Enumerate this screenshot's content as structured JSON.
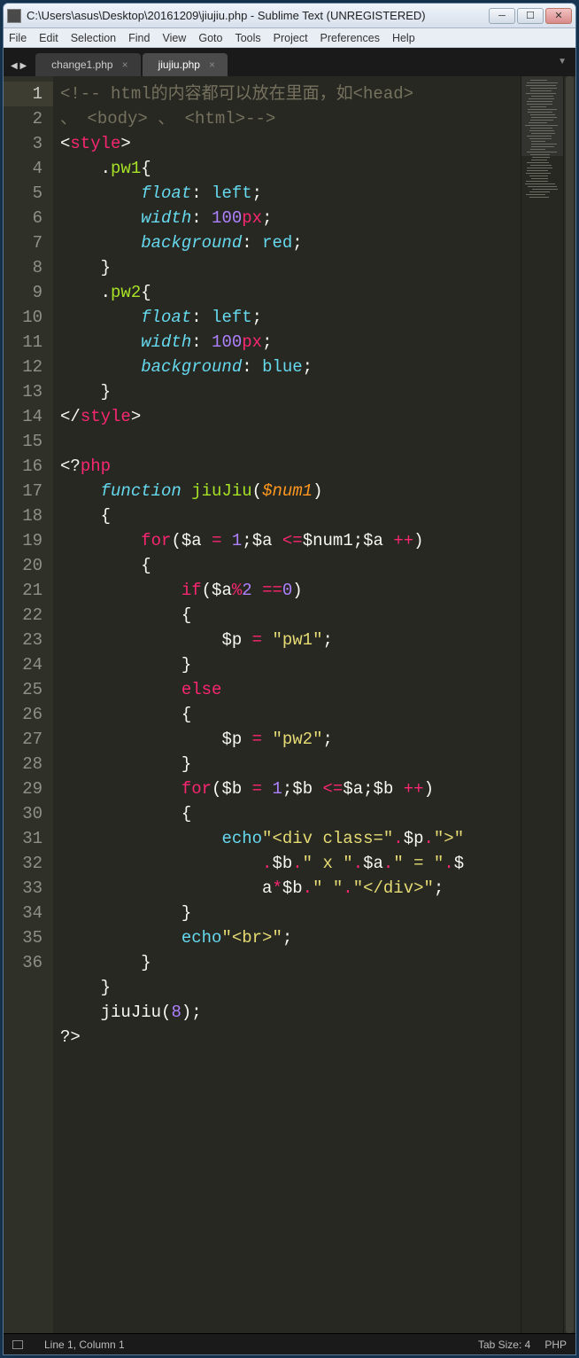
{
  "window": {
    "title": "C:\\Users\\asus\\Desktop\\20161209\\jiujiu.php - Sublime Text (UNREGISTERED)"
  },
  "menu": [
    "File",
    "Edit",
    "Selection",
    "Find",
    "View",
    "Goto",
    "Tools",
    "Project",
    "Preferences",
    "Help"
  ],
  "tabs": [
    {
      "label": "change1.php",
      "active": false
    },
    {
      "label": "jiujiu.php",
      "active": true
    }
  ],
  "status": {
    "left": "Line 1, Column 1",
    "tabSize": "Tab Size: 4",
    "lang": "PHP"
  },
  "code": {
    "lines": 36,
    "l1a": "<!-- html的内容都可以放在里面，如",
    "l1b": "head",
    "l1cont": "、 ",
    "l1body": "body",
    "l1mid": " 、 ",
    "l1html": "html",
    "l1end": "-->",
    "style": "style",
    "pw1": "pw1",
    "pw2": "pw2",
    "floatk": "float",
    "left": "left",
    "widthk": "width",
    "hundred": "100",
    "px": "px",
    "bgk": "background",
    "red": "red",
    "blue": "blue",
    "php": "php",
    "function": "function",
    "jiuJiu": "jiuJiu",
    "num1": "$num1",
    "for": "for",
    "a": "$a",
    "b": "$b",
    "p": "$p",
    "one": "1",
    "ifk": "if",
    "two": "2",
    "zero": "0",
    "elsek": "else",
    "s_pw1": "\"pw1\"",
    "s_pw2": "\"pw2\"",
    "echo": "echo",
    "s_divopen": "\"<div class=\"",
    "s_gt": "\">\"",
    "s_x": "\" x \"",
    "s_eq": "\" = \"",
    "s_dot": "\" \"",
    "s_divclose": "\"</div>\"",
    "s_br": "\"<br>\"",
    "eight": "8",
    "endphp": "?>"
  }
}
